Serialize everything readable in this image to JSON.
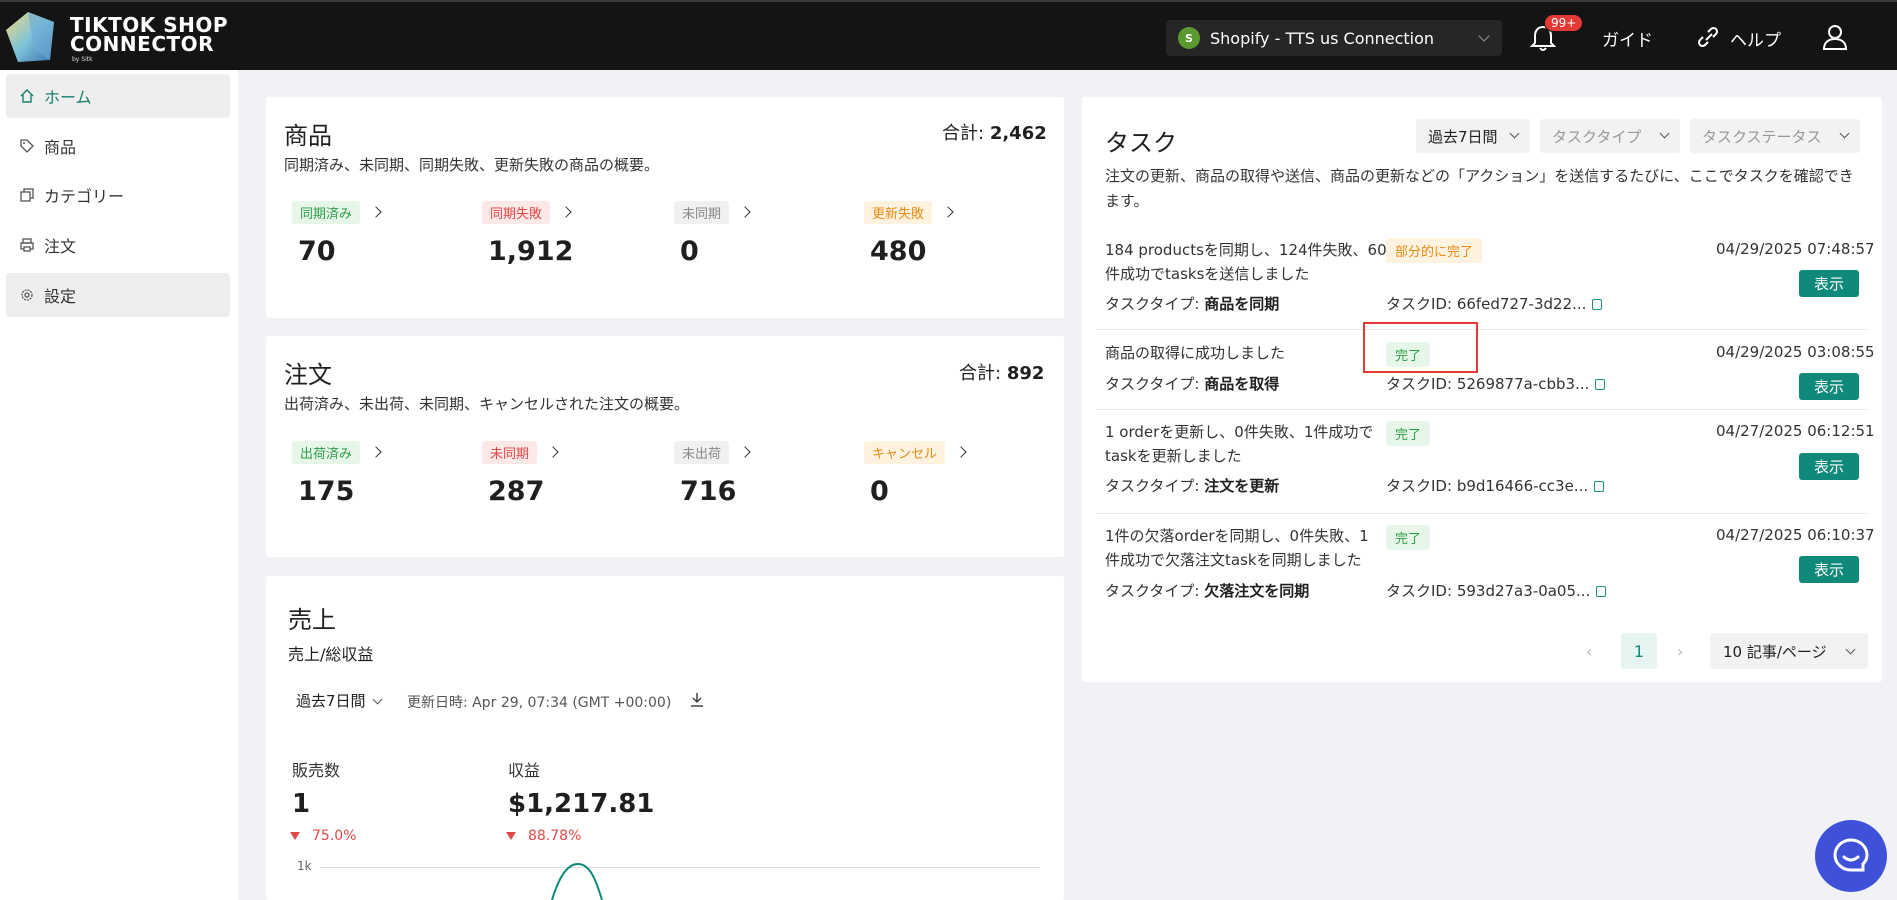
{
  "header": {
    "logo_line1": "TIKTOK SHOP",
    "logo_line2": "CONNECTOR",
    "logo_sub": "by Sitk",
    "connection": "Shopify - TTS us Connection",
    "notification_count": "99+",
    "guide": "ガイド",
    "help": "ヘルプ"
  },
  "sidebar": {
    "items": [
      {
        "label": "ホーム",
        "icon": "home-icon"
      },
      {
        "label": "商品",
        "icon": "tag-icon"
      },
      {
        "label": "カテゴリー",
        "icon": "copy-icon"
      },
      {
        "label": "注文",
        "icon": "printer-icon"
      },
      {
        "label": "設定",
        "icon": "gear-icon"
      }
    ]
  },
  "products": {
    "title": "商品",
    "total_label": "合計:",
    "total": "2,462",
    "desc": "同期済み、未同期、同期失敗、更新失敗の商品の概要。",
    "stats": [
      {
        "label": "同期済み",
        "value": "70"
      },
      {
        "label": "同期失敗",
        "value": "1,912"
      },
      {
        "label": "未同期",
        "value": "0"
      },
      {
        "label": "更新失敗",
        "value": "480"
      }
    ]
  },
  "orders": {
    "title": "注文",
    "total_label": "合計:",
    "total": "892",
    "desc": "出荷済み、未出荷、未同期、キャンセルされた注文の概要。",
    "stats": [
      {
        "label": "出荷済み",
        "value": "175"
      },
      {
        "label": "未同期",
        "value": "287"
      },
      {
        "label": "未出荷",
        "value": "716"
      },
      {
        "label": "キャンセル",
        "value": "0"
      }
    ]
  },
  "sales": {
    "title": "売上",
    "subtitle": "売上/総収益",
    "period": "過去7日間",
    "updated": "更新日時:  Apr 29, 07:34 (GMT +00:00)",
    "units_label": "販売数",
    "units_value": "1",
    "units_delta": "75.0%",
    "revenue_label": "収益",
    "revenue_value": "$1,217.81",
    "revenue_delta": "88.78%",
    "y_tick": "1k"
  },
  "tasks": {
    "title": "タスク",
    "filter_period": "過去7日間",
    "filter_type": "タスクタイプ",
    "filter_status": "タスクステータス",
    "desc": "注文の更新、商品の取得や送信、商品の更新などの「アクション」を送信するたびに、ここでタスクを確認できます。",
    "type_label": "タスクタイプ:",
    "id_label": "タスクID:",
    "view_label": "表示",
    "items": [
      {
        "text1": "184 productsを同期し、124件失敗、60",
        "text2": "件成功でtasksを送信しました",
        "status": "部分的に完了",
        "type": "商品を同期",
        "id": "66fed727-3d22...",
        "date": "04/29/2025 07:48:57"
      },
      {
        "text1": "商品の取得に成功しました",
        "text2": "",
        "status": "完了",
        "type": "商品を取得",
        "id": "5269877a-cbb3...",
        "date": "04/29/2025 03:08:55"
      },
      {
        "text1": "1 orderを更新し、0件失敗、1件成功で",
        "text2": "taskを更新しました",
        "status": "完了",
        "type": "注文を更新",
        "id": "b9d16466-cc3e...",
        "date": "04/27/2025 06:12:51"
      },
      {
        "text1": "1件の欠落orderを同期し、0件失敗、1",
        "text2": "件成功で欠落注文taskを同期しました",
        "status": "完了",
        "type": "欠落注文を同期",
        "id": "593d27a3-0a05...",
        "date": "04/27/2025 06:10:37"
      }
    ],
    "page": "1",
    "page_size": "10 記事/ページ"
  }
}
